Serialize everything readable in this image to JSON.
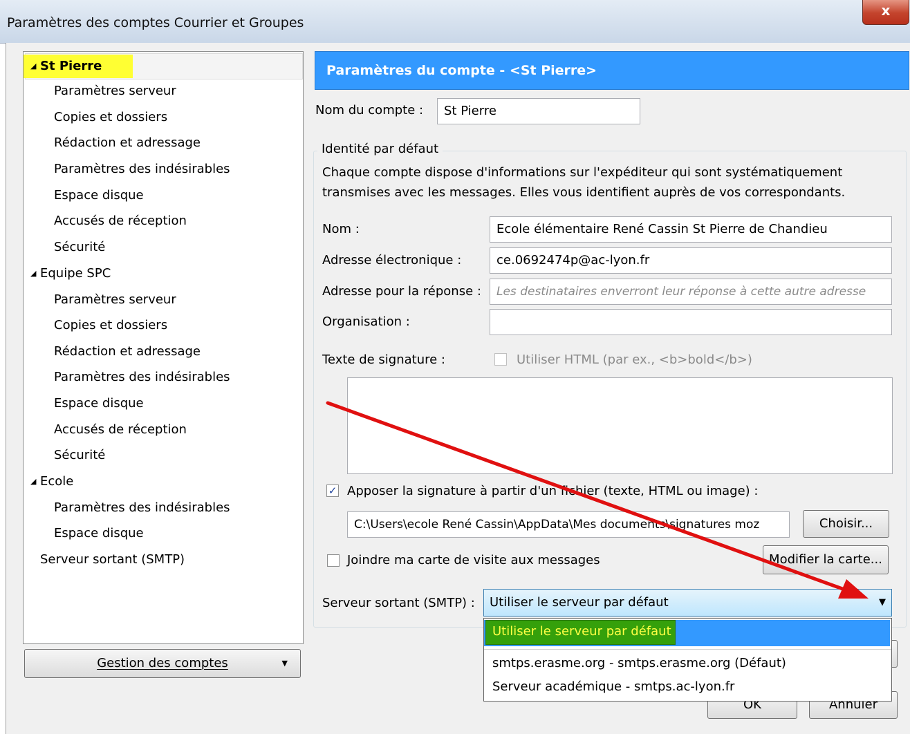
{
  "window": {
    "title": "Paramètres des comptes Courrier et Groupes",
    "close_label": "x"
  },
  "tree": {
    "accounts": [
      {
        "label": "St Pierre",
        "selected": true,
        "items": [
          "Paramètres serveur",
          "Copies et dossiers",
          "Rédaction et adressage",
          "Paramètres des indésirables",
          "Espace disque",
          "Accusés de réception",
          "Sécurité"
        ]
      },
      {
        "label": "Equipe SPC",
        "selected": false,
        "items": [
          "Paramètres serveur",
          "Copies et dossiers",
          "Rédaction et adressage",
          "Paramètres des indésirables",
          "Espace disque",
          "Accusés de réception",
          "Sécurité"
        ]
      },
      {
        "label": "Ecole",
        "selected": false,
        "items": [
          "Paramètres des indésirables",
          "Espace disque"
        ]
      }
    ],
    "smtp_label": "Serveur sortant (SMTP)",
    "manage_button": "Gestion des comptes"
  },
  "panel": {
    "header": "Paramètres du compte - <St Pierre>",
    "account_name_label": "Nom du compte :",
    "account_name_value": "St Pierre",
    "identity_legend": "Identité par défaut",
    "identity_desc_line1": "Chaque compte dispose d'informations sur l'expéditeur qui sont systématiquement",
    "identity_desc_line2": "transmises avec les messages. Elles vous identifient auprès de vos correspondants.",
    "name_label": "Nom :",
    "name_value": "Ecole élémentaire René Cassin St Pierre de Chandieu",
    "email_label": "Adresse électronique :",
    "email_value": "ce.0692474p@ac-lyon.fr",
    "reply_label": "Adresse pour la réponse :",
    "reply_placeholder": "Les destinataires enverront leur réponse à cette autre adresse",
    "org_label": "Organisation :",
    "org_value": "",
    "sig_label": "Texte de signature :",
    "html_checkbox_label": "Utiliser HTML (par ex., <b>bold</b>)",
    "html_checked": false,
    "sig_file_label": "Apposer la signature à partir d'un fichier (texte, HTML ou image) :",
    "sig_file_checked": true,
    "sig_file_path": "C:\\Users\\ecole René Cassin\\AppData\\Mes documents\\signatures moz",
    "choose_button": "Choisir...",
    "vcard_label": "Joindre ma carte de visite aux messages",
    "vcard_checked": false,
    "edit_card_button": "Modifier la carte...",
    "smtp_label": "Serveur sortant (SMTP) :",
    "smtp_selected": "Utiliser le serveur par défaut",
    "smtp_options": [
      "Utiliser le serveur par défaut",
      "smtps.erasme.org - smtps.erasme.org (Défaut)",
      "Serveur académique - smtps.ac-lyon.fr"
    ]
  },
  "footer": {
    "ok": "OK",
    "cancel": "Annuler"
  },
  "colors": {
    "header_blue": "#3399ff",
    "highlight_yellow": "#ffff33",
    "highlight_green": "#35a00b",
    "arrow_red": "#e01010"
  }
}
